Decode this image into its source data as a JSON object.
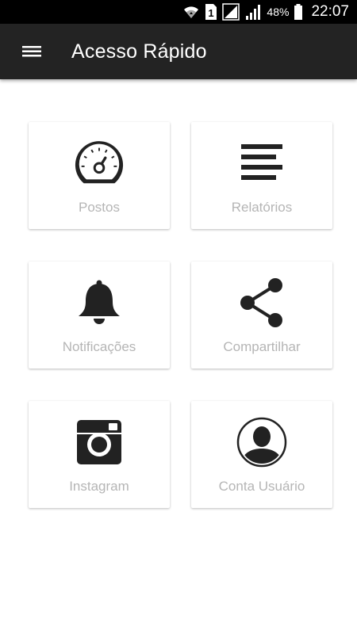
{
  "status_bar": {
    "sim_label": "1",
    "battery": "48%",
    "time": "22:07"
  },
  "app_bar": {
    "title": "Acesso Rápido",
    "menu_icon": "hamburger-menu-icon"
  },
  "cards": [
    {
      "label": "Postos",
      "icon": "speedometer-icon"
    },
    {
      "label": "Relatórios",
      "icon": "report-lines-icon"
    },
    {
      "label": "Notificações",
      "icon": "bell-icon"
    },
    {
      "label": "Compartilhar",
      "icon": "share-icon"
    },
    {
      "label": "Instagram",
      "icon": "instagram-icon"
    },
    {
      "label": "Conta Usuário",
      "icon": "user-account-icon"
    }
  ],
  "colors": {
    "status_bar": "#000000",
    "app_bar": "#232323",
    "background": "#ffffff",
    "card_label": "#b5b5b5",
    "icon": "#222222"
  }
}
